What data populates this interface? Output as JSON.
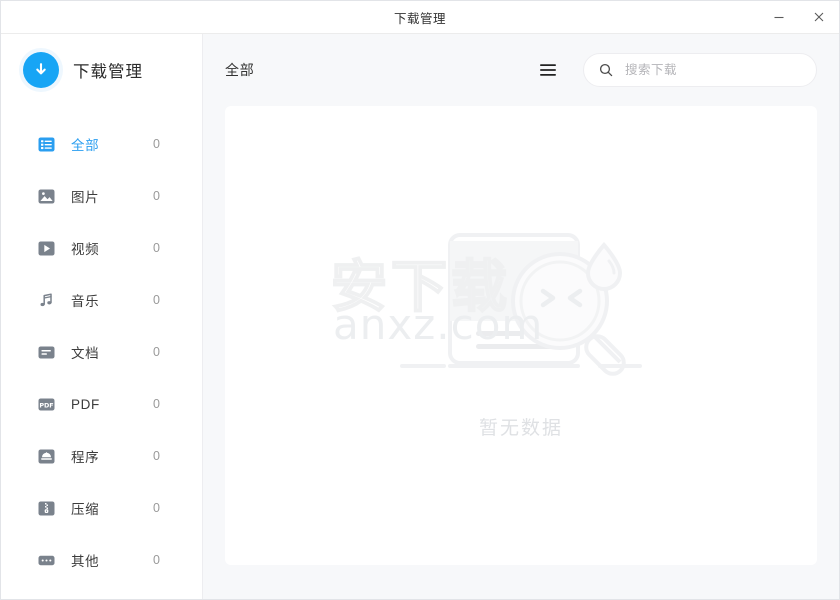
{
  "window": {
    "title": "下载管理",
    "controls": {
      "minimize": "minimize-button",
      "close": "close-button"
    }
  },
  "sidebar": {
    "brand": {
      "title": "下载管理",
      "logo_icon": "download-arrow-icon",
      "logo_color": "#17a5f5"
    },
    "active_index": 0,
    "items": [
      {
        "label": "全部",
        "count": "0",
        "icon": "list-icon",
        "active": true
      },
      {
        "label": "图片",
        "count": "0",
        "icon": "image-icon",
        "active": false
      },
      {
        "label": "视频",
        "count": "0",
        "icon": "video-icon",
        "active": false
      },
      {
        "label": "音乐",
        "count": "0",
        "icon": "music-icon",
        "active": false
      },
      {
        "label": "文档",
        "count": "0",
        "icon": "document-icon",
        "active": false
      },
      {
        "label": "PDF",
        "count": "0",
        "icon": "pdf-icon",
        "active": false
      },
      {
        "label": "程序",
        "count": "0",
        "icon": "program-icon",
        "active": false
      },
      {
        "label": "压缩",
        "count": "0",
        "icon": "archive-icon",
        "active": false
      },
      {
        "label": "其他",
        "count": "0",
        "icon": "more-icon",
        "active": false
      }
    ]
  },
  "toolbar": {
    "title": "全部",
    "menu_icon": "hamburger-menu-icon",
    "search": {
      "icon": "search-icon",
      "placeholder": "搜索下载",
      "value": ""
    }
  },
  "content": {
    "empty": {
      "text": "暂无数据",
      "illustration": "no-data-magnifier-illustration"
    },
    "watermark": {
      "line1": "安下载",
      "line2": "anxz.com"
    }
  },
  "colors": {
    "accent": "#2a9ef0",
    "logo": "#17a5f5",
    "icon_grey": "#7a828c",
    "window_bg": "#f7f8fa",
    "card_bg": "#ffffff",
    "empty_text": "#dfe1e4"
  }
}
